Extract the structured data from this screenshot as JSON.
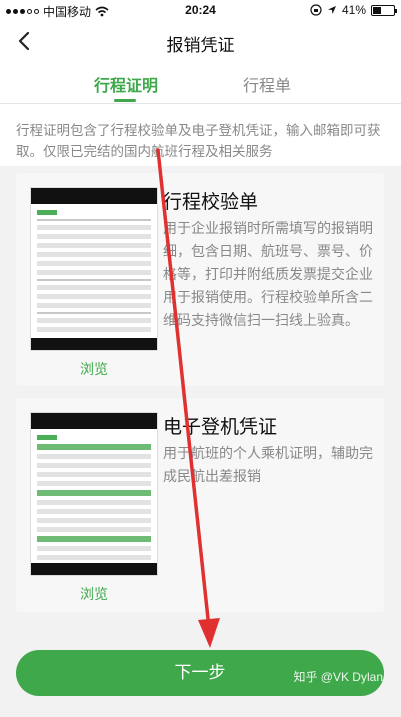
{
  "status": {
    "carrier": "中国移动",
    "time": "20:24",
    "battery": "41%",
    "battery_fraction": 0.41
  },
  "nav": {
    "title": "报销凭证",
    "back_icon": "chevron-left-icon"
  },
  "tabs": [
    {
      "label": "行程证明",
      "active": true
    },
    {
      "label": "行程单",
      "active": false
    }
  ],
  "description": "行程证明包含了行程校验单及电子登机凭证，输入邮箱即可获取。仅限已完结的国内航班行程及相关服务",
  "cards": [
    {
      "title": "行程校验单",
      "text": "用于企业报销时所需填写的报销明细，包含日期、航班号、票号、价格等，打印并附纸质发票提交企业用于报销使用。行程校验单所含二维码支持微信扫一扫线上验真。",
      "browse_label": "浏览"
    },
    {
      "title": "电子登机凭证",
      "text": "用于航班的个人乘机证明，辅助完成民航出差报销",
      "browse_label": "浏览"
    }
  ],
  "next_button": "下一步",
  "watermark": "知乎 @VK Dylan",
  "colors": {
    "accent": "#3ea84a",
    "annotation_arrow": "#e0302f"
  }
}
